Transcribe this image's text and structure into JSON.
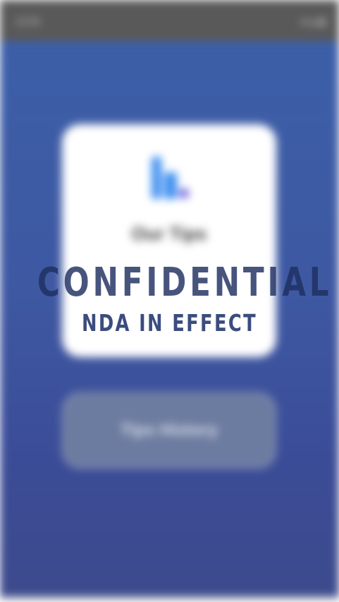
{
  "status_bar": {
    "time": "10:00",
    "icons": [
      "wifi-icon",
      "signal-icon",
      "battery-icon"
    ]
  },
  "tips_card": {
    "logo": "tips-logo-icon",
    "title": "Our Tips",
    "subtitle": "",
    "logo_colors": [
      "#3d8ef0",
      "#6a5bd8"
    ]
  },
  "history_button": {
    "label": "Tips History"
  },
  "watermark": {
    "main": "CONFIDENTIAL",
    "sub": "NDA IN EFFECT"
  },
  "colors": {
    "background": "#3e58a2",
    "status_bar": "#595959",
    "card": "#ffffff",
    "button": "#6c7ba0"
  }
}
